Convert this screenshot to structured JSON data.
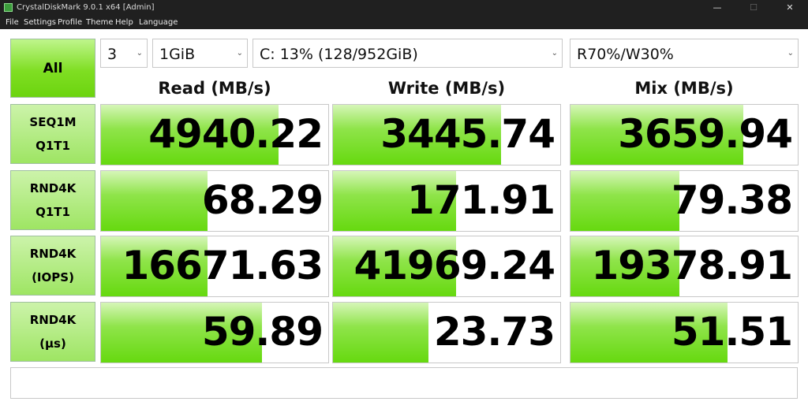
{
  "window": {
    "title": "CrystalDiskMark 9.0.1 x64 [Admin]",
    "min_glyph": "—",
    "max_glyph": "☐",
    "close_glyph": "✕"
  },
  "menu": [
    "File",
    "Settings",
    "Profile",
    "Theme",
    "Help",
    "Language"
  ],
  "controls": {
    "all_label": "All",
    "count": "3",
    "size": "1GiB",
    "drive": "C: 13% (128/952GiB)",
    "mix": "R70%/W30%",
    "chevron": "⌄"
  },
  "headers": {
    "read": "Read (MB/s)",
    "write": "Write (MB/s)",
    "mix": "Mix (MB/s)"
  },
  "rows": [
    {
      "line1": "SEQ1M",
      "line2": "Q1T1",
      "read": "4940.22",
      "write": "3445.74",
      "mix": "3659.94",
      "read_fill": 0.78,
      "write_fill": 0.74,
      "mix_fill": 0.76
    },
    {
      "line1": "RND4K",
      "line2": "Q1T1",
      "read": "68.29",
      "write": "171.91",
      "mix": "79.38",
      "read_fill": 0.47,
      "write_fill": 0.54,
      "mix_fill": 0.48
    },
    {
      "line1": "RND4K",
      "line2": "(IOPS)",
      "read": "16671.63",
      "write": "41969.24",
      "mix": "19378.91",
      "read_fill": 0.47,
      "write_fill": 0.54,
      "mix_fill": 0.48
    },
    {
      "line1": "RND4K",
      "line2": "(μs)",
      "read": "59.89",
      "write": "23.73",
      "mix": "51.51",
      "read_fill": 0.71,
      "write_fill": 0.42,
      "mix_fill": 0.69
    }
  ],
  "status_text": ""
}
